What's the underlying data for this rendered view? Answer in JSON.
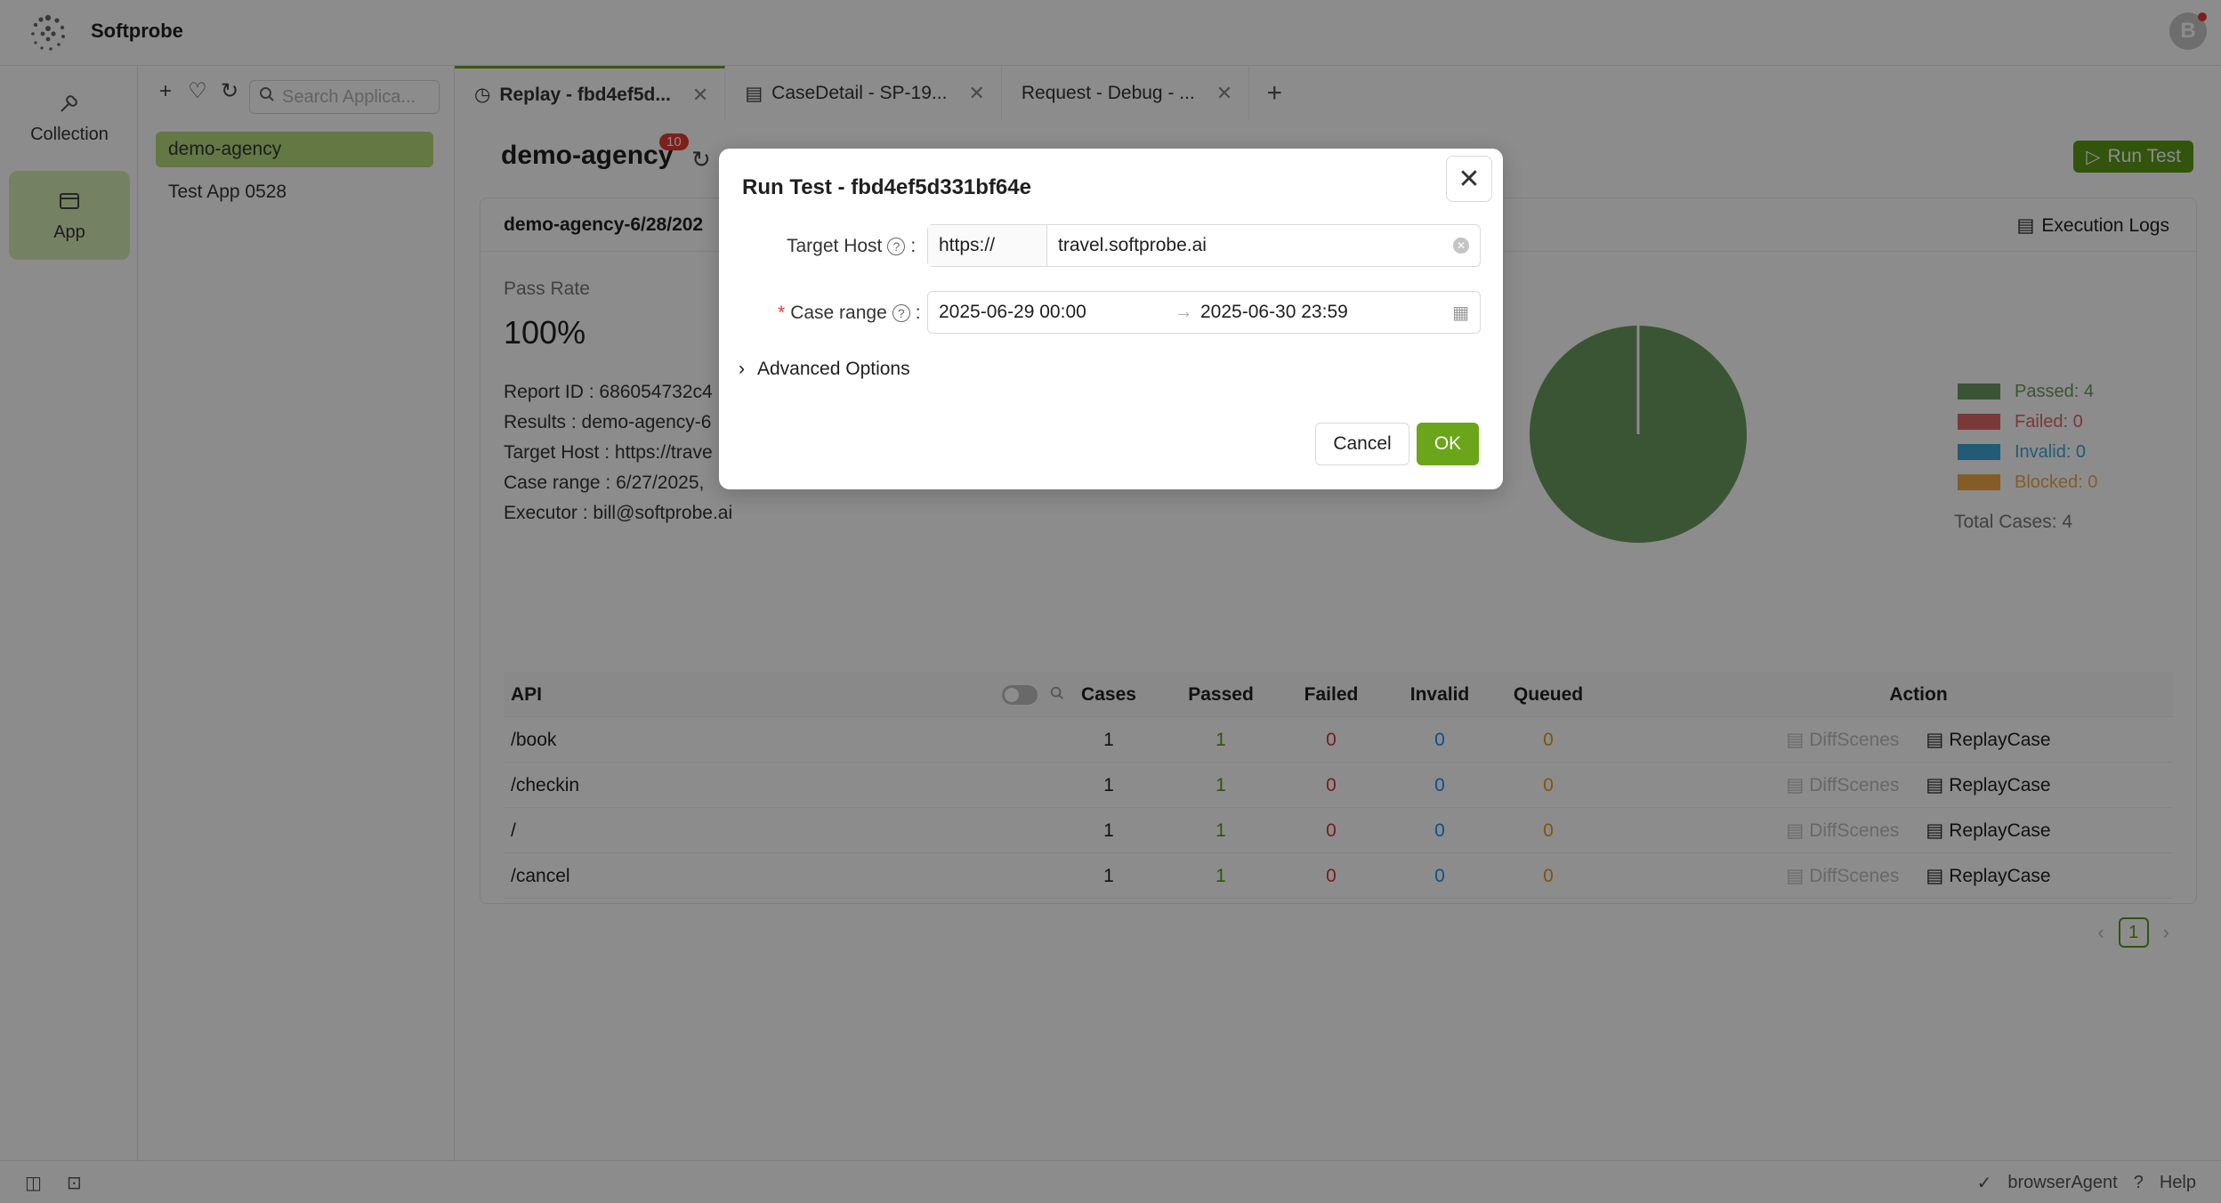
{
  "app": {
    "brand": "Softprobe",
    "user_initial": "B"
  },
  "rail": {
    "items": [
      {
        "label": "Collection",
        "icon": "collection-icon",
        "active": false
      },
      {
        "label": "App",
        "icon": "app-window-icon",
        "active": true
      }
    ]
  },
  "apps_panel": {
    "search_placeholder": "Search Applica...",
    "items": [
      {
        "label": "demo-agency",
        "active": true
      },
      {
        "label": "Test App 0528",
        "active": false
      }
    ]
  },
  "tabs": [
    {
      "label": "Replay - fbd4ef5d...",
      "icon": "replay-icon",
      "active": true
    },
    {
      "label": "CaseDetail - SP-19...",
      "icon": "case-detail-icon",
      "active": false
    },
    {
      "label": "Request - Debug - ...",
      "icon": "",
      "active": false
    }
  ],
  "main": {
    "title": "demo-agency",
    "badge": "10",
    "run_test_label": "Run Test",
    "report_title": "demo-agency-6/28/202",
    "execution_logs_label": "Execution Logs",
    "pass_rate_label": "Pass Rate",
    "pass_rate_value": "100%",
    "info": [
      {
        "label": "Report ID :",
        "value": "686054732c4"
      },
      {
        "label": "Results :",
        "value": "demo-agency-6"
      },
      {
        "label": "Target Host :",
        "value": "https://trave"
      },
      {
        "label": "Case range :",
        "value": "6/27/2025,"
      },
      {
        "label": "Executor :",
        "value": "bill@softprobe.ai"
      }
    ],
    "legend": [
      {
        "label": "Passed: 4",
        "color": "#6b9b5e"
      },
      {
        "label": "Failed: 0",
        "color": "#e06666"
      },
      {
        "label": "Invalid: 0",
        "color": "#3ea7d6"
      },
      {
        "label": "Blocked: 0",
        "color": "#f0a84a"
      }
    ],
    "total_cases": "Total Cases: 4",
    "pie": {
      "passed": 4,
      "failed": 0,
      "invalid": 0,
      "blocked": 0
    }
  },
  "table": {
    "headers": {
      "api": "API",
      "cases": "Cases",
      "passed": "Passed",
      "failed": "Failed",
      "invalid": "Invalid",
      "queued": "Queued",
      "action": "Action"
    },
    "rows": [
      {
        "api": "/book",
        "cases": "1",
        "passed": "1",
        "failed": "0",
        "invalid": "0",
        "queued": "0",
        "diff": "DiffScenes",
        "replay": "ReplayCase"
      },
      {
        "api": "/checkin",
        "cases": "1",
        "passed": "1",
        "failed": "0",
        "invalid": "0",
        "queued": "0",
        "diff": "DiffScenes",
        "replay": "ReplayCase"
      },
      {
        "api": "/",
        "cases": "1",
        "passed": "1",
        "failed": "0",
        "invalid": "0",
        "queued": "0",
        "diff": "DiffScenes",
        "replay": "ReplayCase"
      },
      {
        "api": "/cancel",
        "cases": "1",
        "passed": "1",
        "failed": "0",
        "invalid": "0",
        "queued": "0",
        "diff": "DiffScenes",
        "replay": "ReplayCase"
      }
    ],
    "page": "1"
  },
  "statusbar": {
    "agent": "browserAgent",
    "help": "Help"
  },
  "modal": {
    "title": "Run Test - fbd4ef5d331bf64e",
    "target_host_label": "Target Host",
    "protocol": "https://",
    "host_value": "travel.softprobe.ai",
    "case_range_label": "Case range",
    "range_start": "2025-06-29 00:00",
    "range_end": "2025-06-30 23:59",
    "advanced_label": "Advanced Options",
    "cancel_label": "Cancel",
    "ok_label": "OK"
  }
}
